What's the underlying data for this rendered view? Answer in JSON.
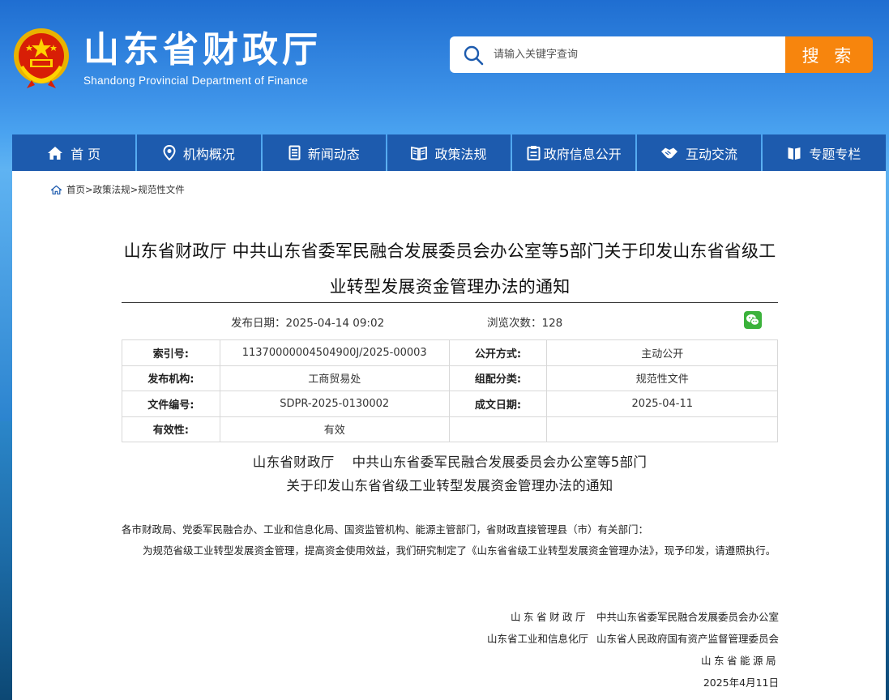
{
  "header": {
    "title": "山东省财政厅",
    "subtitle": "Shandong Provincial Department of Finance",
    "search_placeholder": "请输入关键字查询",
    "search_button": "搜 索"
  },
  "nav": {
    "items": [
      {
        "label": "首 页",
        "icon": "home-icon"
      },
      {
        "label": "机构概况",
        "icon": "location-pin-icon"
      },
      {
        "label": "新闻动态",
        "icon": "document-icon"
      },
      {
        "label": "政策法规",
        "icon": "book-icon"
      },
      {
        "label": "政府信息公开",
        "icon": "clipboard-icon"
      },
      {
        "label": "互动交流",
        "icon": "handshake-icon"
      },
      {
        "label": "专题专栏",
        "icon": "bookmark-icon"
      }
    ]
  },
  "breadcrumb": {
    "home": "首页",
    "sep": ">",
    "level1": "政策法规",
    "level2": "规范性文件"
  },
  "article": {
    "title": "山东省财政厅 中共山东省委军民融合发展委员会办公室等5部门关于印发山东省省级工业转型发展资金管理办法的通知",
    "date_label": "发布日期：",
    "date": "2025-04-14 09:02",
    "views_label": "浏览次数：",
    "views": "128"
  },
  "info_table": {
    "rows": [
      {
        "l1": "索引号:",
        "v1": "11370000004504900J/2025-00003",
        "l2": "公开方式:",
        "v2": "主动公开"
      },
      {
        "l1": "发布机构:",
        "v1": "工商贸易处",
        "l2": "组配分类:",
        "v2": "规范性文件"
      },
      {
        "l1": "文件编号:",
        "v1": "SDPR-2025-0130002",
        "l2": "成文日期:",
        "v2": "2025-04-11"
      },
      {
        "l1": "有效性:",
        "v1": "有效",
        "l2": "",
        "v2": ""
      }
    ]
  },
  "doc": {
    "heading_line1_a": "山东省财政厅",
    "heading_line1_b": "中共山东省委军民融合发展委员会办公室等5部门",
    "heading_line2": "关于印发山东省省级工业转型发展资金管理办法的通知",
    "para1": "各市财政局、党委军民融合办、工业和信息化局、国资监管机构、能源主管部门，省财政直接管理县（市）有关部门：",
    "para2": "为规范省级工业转型发展资金管理，提高资金使用效益，我们研究制定了《山东省省级工业转型发展资金管理办法》，现予印发，请遵照执行。",
    "sign1_a": "山东省财政厅",
    "sign1_b": "中共山东省委军民融合发展委员会办公室",
    "sign2_a": "山东省工业和信息化厅",
    "sign2_b": "山东省人民政府国有资产监督管理委员会",
    "sign3": "山东省能源局",
    "sign_date": "2025年4月11日"
  },
  "colors": {
    "nav_bg": "#1d5bae",
    "search_button_bg": "#f7850d",
    "header_bg": "#1f6ed1"
  }
}
